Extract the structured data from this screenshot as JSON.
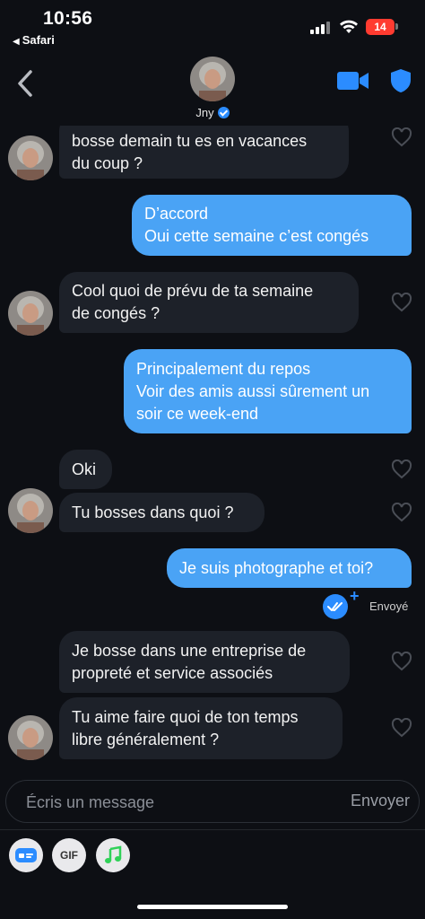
{
  "status_bar": {
    "time": "10:56",
    "back_app": "Safari",
    "battery": "14"
  },
  "header": {
    "contact_name": "Jny",
    "verified": true,
    "icons": [
      "chevron-left-icon",
      "video-camera-icon",
      "shield-icon"
    ],
    "accent_color": "#2b8cff"
  },
  "messages": [
    {
      "direction": "incoming",
      "text": "bosse demain tu es en vacances\ndu coup ?"
    },
    {
      "direction": "outgoing",
      "text": "D’accord\nOui cette semaine c’est congés"
    },
    {
      "direction": "incoming",
      "text": "Cool quoi de prévu de ta semaine\nde congés ?"
    },
    {
      "direction": "outgoing",
      "text": "Principalement du repos\nVoir des amis aussi sûrement un\nsoir ce week-end"
    },
    {
      "direction": "incoming",
      "text": "Oki"
    },
    {
      "direction": "incoming",
      "text": "Tu bosses dans quoi ?"
    },
    {
      "direction": "outgoing",
      "text": "Je suis photographe et toi?"
    },
    {
      "direction": "incoming",
      "text": "Je bosse dans une entreprise de\npropreté et service associés"
    },
    {
      "direction": "incoming",
      "text": "Tu aime faire quoi de ton temps\nlibre généralement ?"
    }
  ],
  "sent_status": "Envoyé",
  "composer": {
    "placeholder": "Écris un message",
    "send_label": "Envoyer"
  },
  "toolbar": {
    "gif_label": "GIF",
    "icons": [
      "sticker-card-icon",
      "gif-icon",
      "music-note-icon"
    ]
  },
  "colors": {
    "background": "#0d0f14",
    "incoming_bubble": "#1d2129",
    "outgoing_bubble": "#4aa3f5",
    "music_icon": "#2fd158"
  }
}
